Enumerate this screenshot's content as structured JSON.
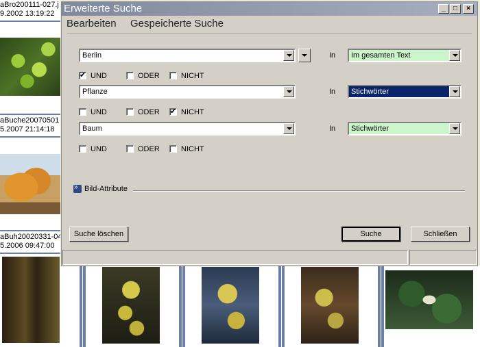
{
  "gallery": {
    "items": [
      {
        "name": "aBro200111-027.j",
        "date": "9.2002 13:19:22"
      },
      {
        "name": "aBuche20070501",
        "date": "5.2007 21:14:18"
      },
      {
        "name": "aBuh20020331-04",
        "date": "5.2006 09:47:00"
      }
    ]
  },
  "dialog": {
    "title": "Erweiterte Suche",
    "controls": {
      "minimize": "_",
      "maximize": "□",
      "close": "×"
    },
    "menu": {
      "edit": "Bearbeiten",
      "saved": "Gespeicherte Suche"
    },
    "in_label": "In",
    "rows": [
      {
        "term": "Berlin",
        "field": "Im gesamten Text",
        "field_style": "normal"
      },
      {
        "term": "Pflanze",
        "field": "Stichwörter",
        "field_style": "selected"
      },
      {
        "term": "Baum",
        "field": "Stichwörter",
        "field_style": "normal"
      }
    ],
    "operators": [
      {
        "und": "UND",
        "oder": "ODER",
        "nicht": "NICHT",
        "checked": "und"
      },
      {
        "und": "UND",
        "oder": "ODER",
        "nicht": "NICHT",
        "checked": "nicht"
      },
      {
        "und": "UND",
        "oder": "ODER",
        "nicht": "NICHT",
        "checked": "none"
      }
    ],
    "section": "Bild-Attribute",
    "buttons": {
      "clear": "Suche löschen",
      "search": "Suche",
      "close": "Schließen"
    },
    "colors": {
      "field_bg": "#ccf5cc",
      "field_selected_bg": "#0a246a"
    }
  }
}
